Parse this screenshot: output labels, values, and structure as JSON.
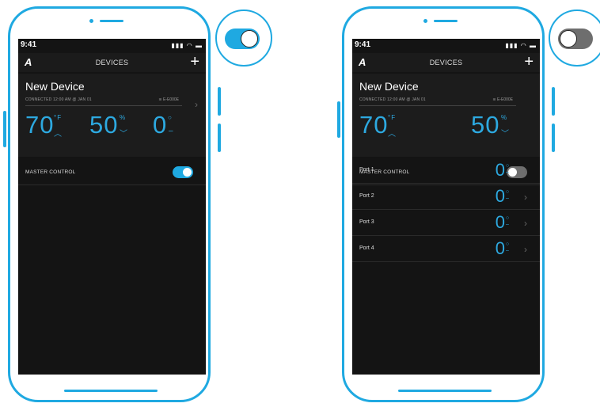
{
  "status_bar": {
    "time": "9:41",
    "icons": "signal wifi battery"
  },
  "nav": {
    "logo": "A",
    "title": "DEVICES",
    "add_label": "+"
  },
  "device": {
    "name": "New Device",
    "connection": "CONNECTED  12:00 AM @ JAN 01",
    "sensor": "E-E000E"
  },
  "left_screen": {
    "temperature": {
      "value": "70",
      "unit": "°F",
      "trend": "up"
    },
    "humidity": {
      "value": "50",
      "unit": "%",
      "trend": "down"
    },
    "port_count": {
      "value": "0"
    },
    "master_control": {
      "label": "MASTER CONTROL",
      "on": true
    }
  },
  "right_screen": {
    "temperature": {
      "value": "70",
      "unit": "°F",
      "trend": "up"
    },
    "humidity": {
      "value": "50",
      "unit": "%",
      "trend": "down"
    },
    "master_control": {
      "label": "MASTER CONTROL",
      "on": false
    },
    "ports": [
      {
        "label": "Port 1",
        "value": "0"
      },
      {
        "label": "Port 2",
        "value": "0"
      },
      {
        "label": "Port 3",
        "value": "0"
      },
      {
        "label": "Port 4",
        "value": "0"
      }
    ]
  },
  "callouts": {
    "left_toggle_on": true,
    "right_toggle_on": false
  },
  "colors": {
    "accent": "#1fa9e1",
    "reading": "#2da9e0",
    "toggle_off": "#6e6e6e",
    "screen_bg": "#141414"
  }
}
